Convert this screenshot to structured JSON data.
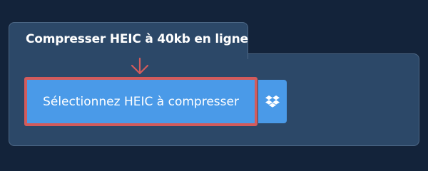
{
  "tab": {
    "title": "Compresser HEIC à 40kb en ligne"
  },
  "upload": {
    "label": "Sélectionnez HEIC à compresser"
  },
  "icons": {
    "arrow": "arrow-down-icon",
    "dropbox": "dropbox-icon"
  },
  "colors": {
    "background": "#13233a",
    "panel": "#2c4868",
    "button": "#4a9ae8",
    "highlight": "#d35b5b"
  }
}
